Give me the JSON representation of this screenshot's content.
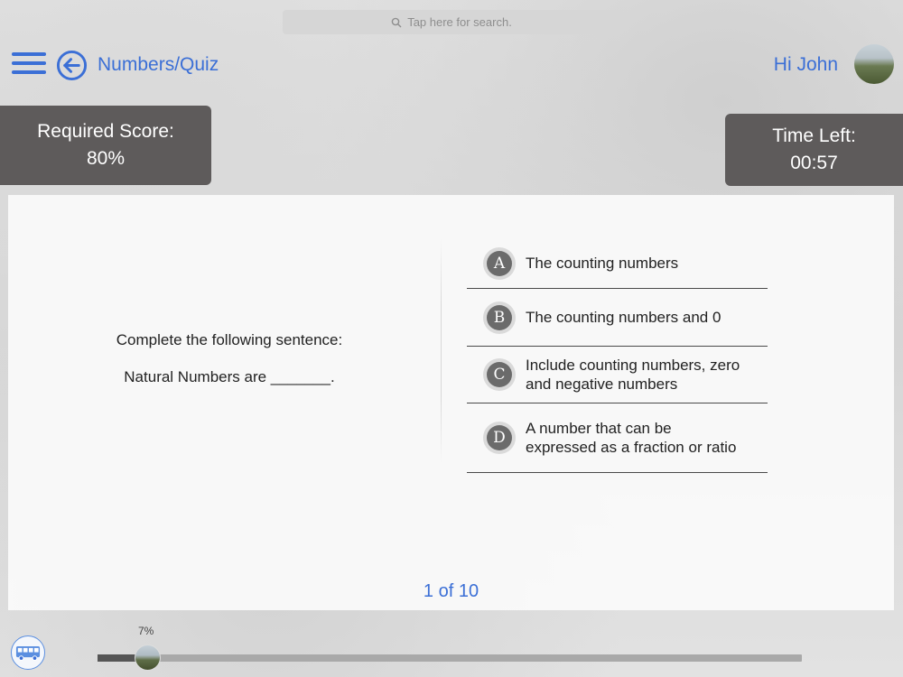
{
  "search": {
    "placeholder": "Tap here for search."
  },
  "header": {
    "breadcrumb": "Numbers/Quiz",
    "greeting": "Hi John"
  },
  "required_score": {
    "label": "Required Score:",
    "value": "80%"
  },
  "time_left": {
    "label": "Time Left:",
    "value": "00:57"
  },
  "question": {
    "line1": "Complete the following sentence:",
    "line2": "Natural Numbers are _______."
  },
  "options": [
    {
      "letter": "A",
      "text": "The counting numbers"
    },
    {
      "letter": "B",
      "text": "The counting numbers and 0"
    },
    {
      "letter": "C",
      "text": "Include counting numbers, zero and negative numbers"
    },
    {
      "letter": "D",
      "text": "A number that can be expressed as a fraction or ratio"
    }
  ],
  "counter": "1 of 10",
  "progress": {
    "label": "7%",
    "value": 0.07
  },
  "colors": {
    "accent": "#3b6fd6",
    "panel": "#5e5b5b"
  },
  "icons": [
    "search-icon",
    "menu-icon",
    "back-arrow-icon",
    "avatar",
    "bus-icon"
  ]
}
